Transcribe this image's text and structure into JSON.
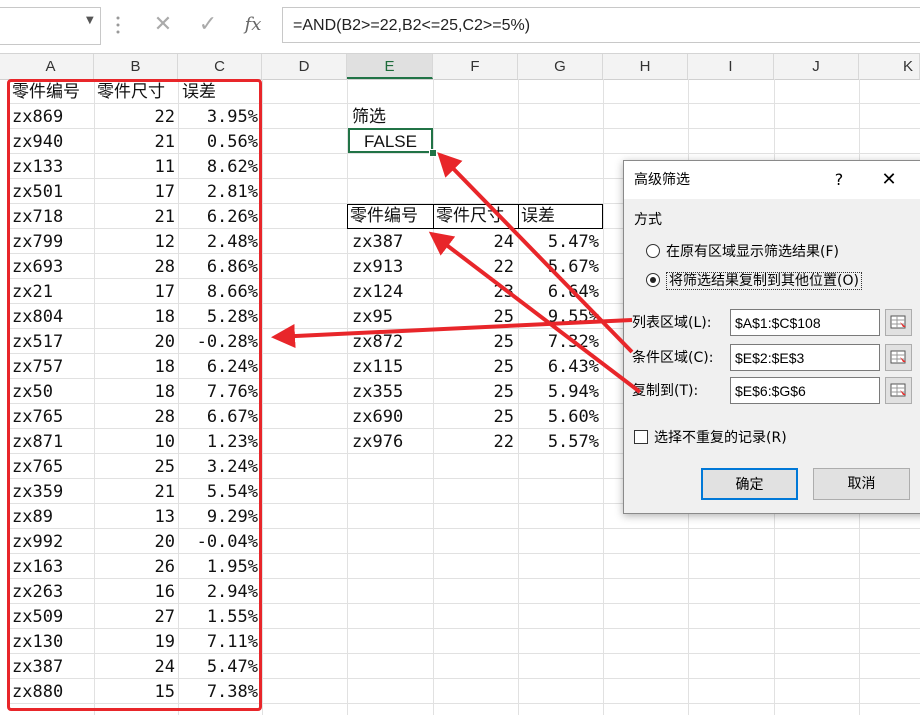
{
  "formula_bar": {
    "formula": "=AND(B2>=22,B2<=25,C2>=5%)",
    "fx_label": "fx",
    "cancel_glyph": "✕",
    "enter_glyph": "✓"
  },
  "columns": [
    "A",
    "B",
    "C",
    "D",
    "E",
    "F",
    "G",
    "H",
    "I",
    "J",
    "K"
  ],
  "table": {
    "headers": [
      "零件编号",
      "零件尺寸",
      "误差"
    ],
    "rows": [
      [
        "zx869",
        "22",
        "3.95%"
      ],
      [
        "zx940",
        "21",
        "0.56%"
      ],
      [
        "zx133",
        "11",
        "8.62%"
      ],
      [
        "zx501",
        "17",
        "2.81%"
      ],
      [
        "zx718",
        "21",
        "6.26%"
      ],
      [
        "zx799",
        "12",
        "2.48%"
      ],
      [
        "zx693",
        "28",
        "6.86%"
      ],
      [
        "zx21",
        "17",
        "8.66%"
      ],
      [
        "zx804",
        "18",
        "5.28%"
      ],
      [
        "zx517",
        "20",
        "-0.28%"
      ],
      [
        "zx757",
        "18",
        "6.24%"
      ],
      [
        "zx50",
        "18",
        "7.76%"
      ],
      [
        "zx765",
        "28",
        "6.67%"
      ],
      [
        "zx871",
        "10",
        "1.23%"
      ],
      [
        "zx765",
        "25",
        "3.24%"
      ],
      [
        "zx359",
        "21",
        "5.54%"
      ],
      [
        "zx89",
        "13",
        "9.29%"
      ],
      [
        "zx992",
        "20",
        "-0.04%"
      ],
      [
        "zx163",
        "26",
        "1.95%"
      ],
      [
        "zx263",
        "16",
        "2.94%"
      ],
      [
        "zx509",
        "27",
        "1.55%"
      ],
      [
        "zx130",
        "19",
        "7.11%"
      ],
      [
        "zx387",
        "24",
        "5.47%"
      ],
      [
        "zx880",
        "15",
        "7.38%"
      ]
    ]
  },
  "criteria": {
    "label": "筛选",
    "value": "FALSE"
  },
  "output": {
    "headers": [
      "零件编号",
      "零件尺寸",
      "误差"
    ],
    "rows": [
      [
        "zx387",
        "24",
        "5.47%"
      ],
      [
        "zx913",
        "22",
        "5.67%"
      ],
      [
        "zx124",
        "23",
        "6.64%"
      ],
      [
        "zx95",
        "25",
        "9.55%"
      ],
      [
        "zx872",
        "25",
        "7.32%"
      ],
      [
        "zx115",
        "25",
        "6.43%"
      ],
      [
        "zx355",
        "25",
        "5.94%"
      ],
      [
        "zx690",
        "25",
        "5.60%"
      ],
      [
        "zx976",
        "22",
        "5.57%"
      ]
    ]
  },
  "dialog": {
    "title": "高级筛选",
    "help": "?",
    "close": "✕",
    "method_label": "方式",
    "radio1": "在原有区域显示筛选结果(F)",
    "radio2": "将筛选结果复制到其他位置(O)",
    "list_range_label": "列表区域(L):",
    "list_range_value": "$A$1:$C$108",
    "criteria_range_label": "条件区域(C):",
    "criteria_range_value": "$E$2:$E$3",
    "copy_to_label": "复制到(T):",
    "copy_to_value": "$E$6:$G$6",
    "unique_label": "选择不重复的记录(R)",
    "ok": "确定",
    "cancel": "取消"
  },
  "colors": {
    "annotation_red": "#e8262a",
    "excel_green": "#217346",
    "dialog_bg": "#f0f0f0"
  }
}
